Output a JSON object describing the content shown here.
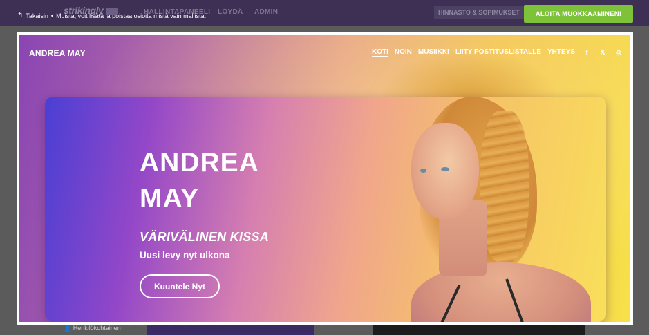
{
  "app": {
    "logo": "strikingly",
    "nav": [
      "HALLINTAPANEELI",
      "LÖYDÄ",
      "ADMIN"
    ],
    "pricing": "HINNASTO & SOPIMUKSET",
    "back_label": "Takaisin",
    "separator": "•",
    "notice": "Muista, voit lisätä ja poistaa osioita mistä vain mallista.",
    "start_button": "ALOITA MUOKKAAMINEN!",
    "below_left": "Henkilökohtainen"
  },
  "site": {
    "logo": "ANDREA MAY",
    "nav": [
      {
        "label": "KOTI",
        "active": true
      },
      {
        "label": "NOIN",
        "active": false
      },
      {
        "label": "MUSIIKKI",
        "active": false
      },
      {
        "label": "LIITY POSTITUSLISTALLE",
        "active": false
      },
      {
        "label": "YHTEYS",
        "active": false
      }
    ],
    "social": {
      "facebook": "f",
      "twitter": "𝕏",
      "instagram": "◎"
    }
  },
  "hero": {
    "title_line1": "ANDREA",
    "title_line2": "MAY",
    "subtitle": "VÄRIVÄLINEN KISSA",
    "description": "Uusi levy nyt ulkona",
    "button": "Kuuntele Nyt"
  },
  "colors": {
    "start_button": "#7ec23a",
    "app_header": "#3e2f55",
    "gradient_start": "#4a3fd4",
    "gradient_end": "#f9df5a"
  }
}
